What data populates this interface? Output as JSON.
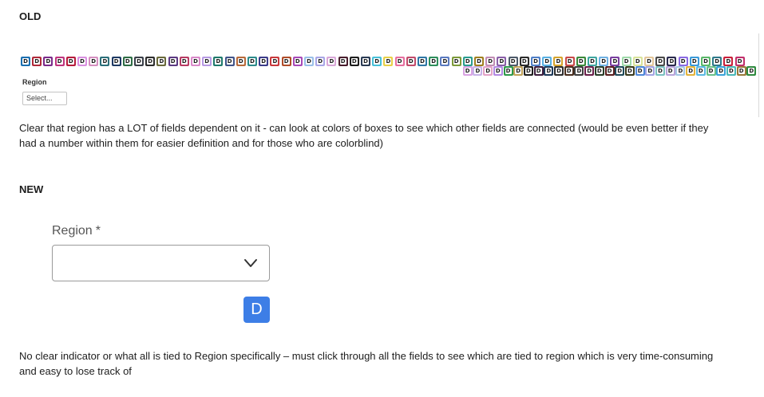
{
  "old": {
    "heading": "OLD",
    "badge_letter": "D",
    "badge_colors_row1": [
      "#1b6fb0",
      "#b02a3a",
      "#7b2a8a",
      "#c0357f",
      "#b71c3c",
      "#d98fe0",
      "#d58fc0",
      "#2b6f7a",
      "#1f3a64",
      "#2f6e46",
      "#3a3f49",
      "#2d2d2d",
      "#6a6a3b",
      "#5d3a83",
      "#b83a63",
      "#d989c9",
      "#b79ae3",
      "#1f7a6c",
      "#41548a",
      "#b86a3a",
      "#2c8b8b",
      "#3c3c8a",
      "#c9393c",
      "#b04d2a",
      "#a84ab8",
      "#9ac0e8",
      "#a9a6e6",
      "#d9a7d8",
      "#4a1e2e",
      "#1e1e1e",
      "#2b3c55",
      "#48c0d8",
      "#e8d048",
      "#e76fa0",
      "#c24b6b",
      "#2f78a6",
      "#2e8f5c",
      "#5a7ac0",
      "#7d9a3a",
      "#2a9d8f",
      "#a08020",
      "#c18db5",
      "#8a5fa8",
      "#4d5a6a",
      "#2b2b2b",
      "#4f7fc7",
      "#58b0e3",
      "#d6a42d",
      "#c94a4a",
      "#3a8a3a",
      "#3fa6a0",
      "#6fb1e3",
      "#7a3ea0",
      "#9ed9a9",
      "#d9e39a",
      "#e3c69a",
      "#4a4a4a",
      "#2b2b4f",
      "#8a6ae3",
      "#3a9ad9",
      "#5ab86a",
      "#2e7a8a",
      "#c9203a",
      "#c22f6b"
    ],
    "badge_colors_row2": [
      "#d9a3e3",
      "#c7b3e8",
      "#e3a3c7",
      "#b38ae3",
      "#2e9a4a",
      "#c2a35a",
      "#1f1f1f",
      "#3d1e3d",
      "#1e3a5a",
      "#2e2e2e",
      "#4a2e1e",
      "#3e3e3e",
      "#6a1f4a",
      "#2a3f2a",
      "#5a1e1e",
      "#1f4a5a",
      "#3a3a1e",
      "#4f88d9",
      "#a3a3e3",
      "#7ac0c0",
      "#b8a3d9",
      "#a3c7e3",
      "#e3b33a",
      "#5ab8e3",
      "#6ac08a",
      "#3aa3d9",
      "#4ab8b8",
      "#9a7a3a",
      "#2e8a3e"
    ],
    "region_label": "Region",
    "select_placeholder": "Select...",
    "comment": "Clear that region has a LOT of fields dependent on it  - can look at colors of boxes to see which other fields are connected (would be even better if they had a number within them for easier definition and for those who are colorblind)"
  },
  "new": {
    "heading": "NEW",
    "region_label": "Region",
    "required_marker": "*",
    "select_value": "",
    "select_icon": "chevron-down-icon",
    "badge_letter": "D",
    "badge_color": "#3d7ee6",
    "comment": "No clear indicator or what all is tied to Region specifically – must click through all the fields to see which are tied to region which is very time-consuming and easy to lose track of"
  }
}
